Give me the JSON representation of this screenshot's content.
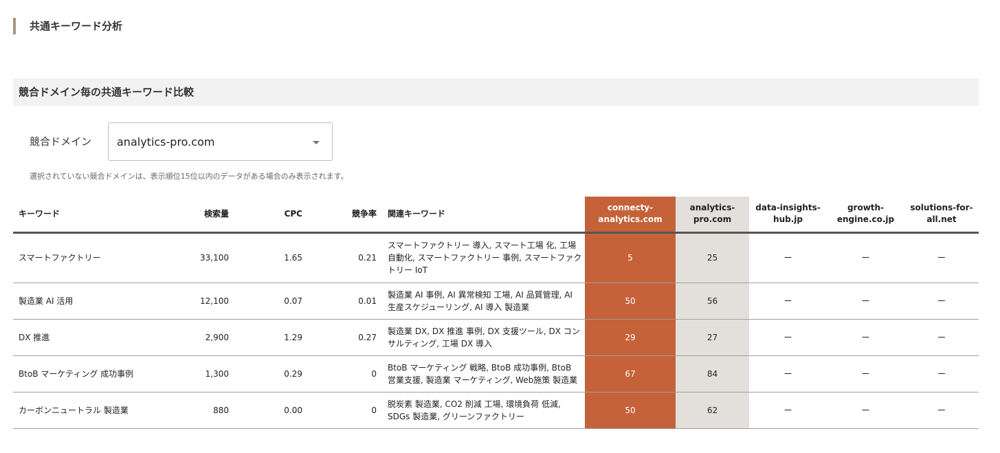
{
  "section_title": "共通キーワード分析",
  "sub_header": "競合ドメイン毎の共通キーワード比較",
  "filter": {
    "label": "競合ドメイン",
    "selected": "analytics-pro.com"
  },
  "note": "選択されていない競合ドメインは、表示順位15位以内のデータがある場合のみ表示されます。",
  "colors": {
    "own_column": "#c5623a",
    "selected_column": "#e3e0dc",
    "accent_bar": "#a89682"
  },
  "table": {
    "headers": {
      "keyword": "キーワード",
      "volume": "検索量",
      "cpc": "CPC",
      "competition": "競争率",
      "related": "関連キーワード",
      "domains": [
        "connecty-analytics.com",
        "analytics-pro.com",
        "data-insights-hub.jp",
        "growth-engine.co.jp",
        "solutions-for-all.net"
      ]
    },
    "rows": [
      {
        "keyword": "スマートファクトリー",
        "volume": "33,100",
        "cpc": "1.65",
        "competition": "0.21",
        "related": "スマートファクトリー 導入, スマート工場 化, 工場 自動化, スマートファクトリー 事例, スマートファクトリー IoT",
        "ranks": [
          "5",
          "25",
          "ー",
          "ー",
          "ー"
        ]
      },
      {
        "keyword": "製造業 AI 活用",
        "volume": "12,100",
        "cpc": "0.07",
        "competition": "0.01",
        "related": "製造業 AI 事例, AI 異常検知 工場, AI 品質管理, AI 生産スケジューリング, AI 導入 製造業",
        "ranks": [
          "50",
          "56",
          "ー",
          "ー",
          "ー"
        ]
      },
      {
        "keyword": "DX 推進",
        "volume": "2,900",
        "cpc": "1.29",
        "competition": "0.27",
        "related": "製造業 DX, DX 推進 事例, DX 支援ツール, DX コンサルティング, 工場 DX 導入",
        "ranks": [
          "29",
          "27",
          "ー",
          "ー",
          "ー"
        ]
      },
      {
        "keyword": "BtoB マーケティング 成功事例",
        "volume": "1,300",
        "cpc": "0.29",
        "competition": "0",
        "related": "BtoB マーケティング 戦略, BtoB 成功事例, BtoB 営業支援, 製造業 マーケティング, Web施策 製造業",
        "ranks": [
          "67",
          "84",
          "ー",
          "ー",
          "ー"
        ]
      },
      {
        "keyword": "カーボンニュートラル 製造業",
        "volume": "880",
        "cpc": "0.00",
        "competition": "0",
        "related": "脱炭素 製造業, CO2 削減 工場, 環境負荷 低減, SDGs 製造業, グリーンファクトリー",
        "ranks": [
          "50",
          "62",
          "ー",
          "ー",
          "ー"
        ]
      }
    ]
  }
}
